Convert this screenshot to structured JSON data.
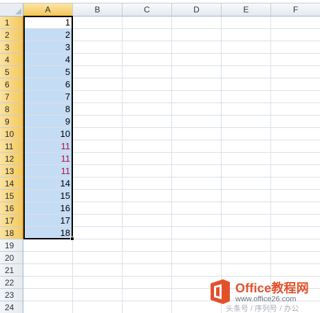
{
  "spreadsheet": {
    "columns": [
      "A",
      "B",
      "C",
      "D",
      "E",
      "F"
    ],
    "selected_column": "A",
    "rows": [
      "1",
      "2",
      "3",
      "4",
      "5",
      "6",
      "7",
      "8",
      "9",
      "10",
      "11",
      "12",
      "13",
      "14",
      "15",
      "16",
      "17",
      "18",
      "19",
      "20",
      "21",
      "22",
      "23",
      "24"
    ],
    "selected_rows": [
      "1",
      "2",
      "3",
      "4",
      "5",
      "6",
      "7",
      "8",
      "9",
      "10",
      "11",
      "12",
      "13",
      "14",
      "15",
      "16",
      "17",
      "18"
    ],
    "column_a_values": [
      "1",
      "2",
      "3",
      "4",
      "5",
      "6",
      "7",
      "8",
      "9",
      "10",
      "11",
      "11",
      "11",
      "14",
      "15",
      "16",
      "17",
      "18"
    ],
    "red_value_rows": [
      11,
      12,
      13
    ],
    "colors": {
      "selection_fill": "#c5dcf5",
      "header_selected": "#f4c95d",
      "red_text": "#b2163a"
    }
  },
  "watermark": {
    "title": "Office教程网",
    "url": "www.office26.com",
    "subtitle": "头条号 / 序列号 / 办公"
  }
}
